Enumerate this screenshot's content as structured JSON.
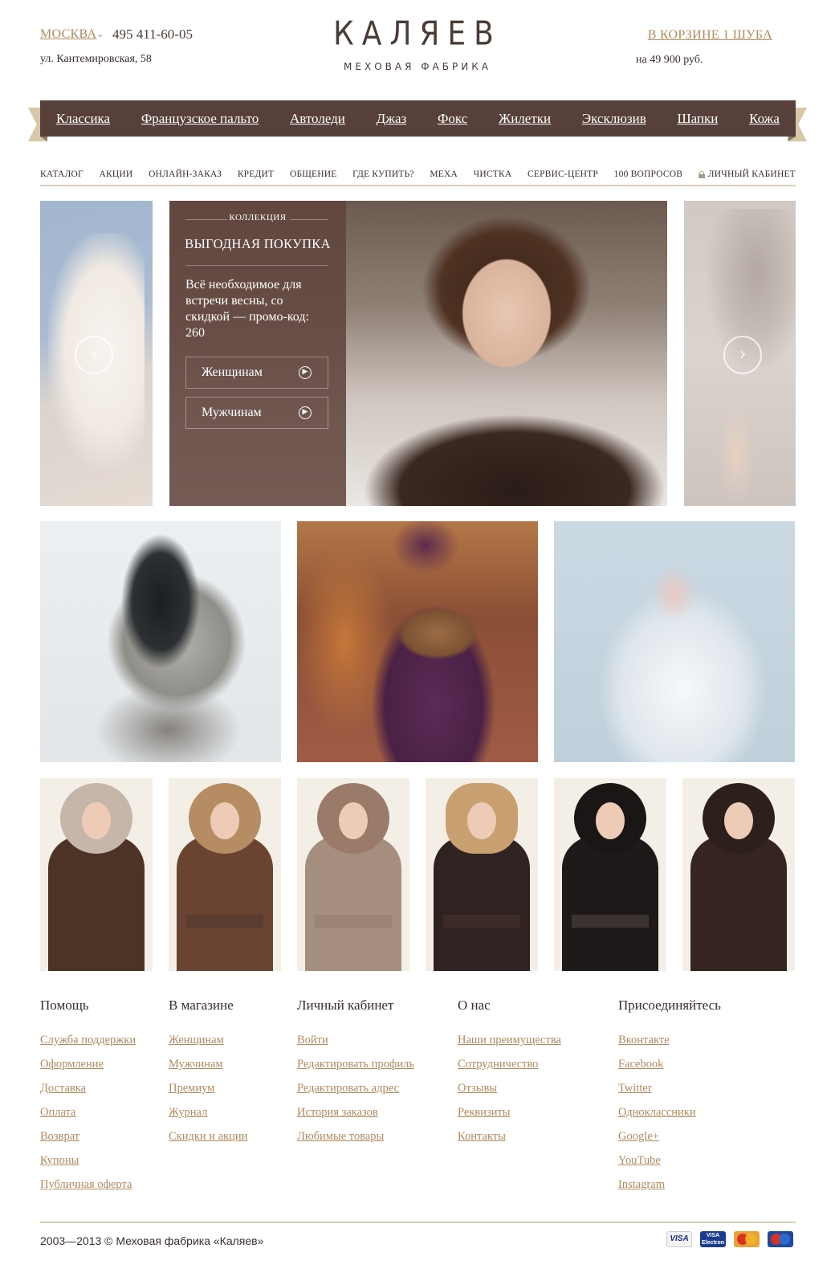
{
  "header": {
    "city": "МОСКВА",
    "phone": "495 411-60-05",
    "address": "ул. Кантемировская, 58",
    "logo": "КАЛЯЕВ",
    "logo_sub": "МЕХОВАЯ ФАБРИКА",
    "cart": "В КОРЗИНЕ 1 ШУБА",
    "cart_sum": "на 49 900 руб."
  },
  "ribbon": {
    "items": [
      "Классика",
      "Французское пальто",
      "Автоледи",
      "Джаз",
      "Фокс",
      "Жилетки",
      "Эксклюзив",
      "Шапки",
      "Кожа"
    ]
  },
  "subnav": {
    "items": [
      "КАТАЛОГ",
      "АКЦИИ",
      "ОНЛАЙН-ЗАКАЗ",
      "КРЕДИТ",
      "ОБЩЕНИЕ",
      "ГДЕ КУПИТЬ?",
      "МЕХА",
      "ЧИСТКА",
      "СЕРВИС-ЦЕНТР",
      "100 ВОПРОСОВ"
    ],
    "account": "ЛИЧНЫЙ КАБИНЕТ"
  },
  "hero": {
    "collection": "КОЛЛЕКЦИЯ",
    "title": "ВЫГОДНАЯ ПОКУПКА",
    "text": "Всё необходимое для встречи весны, со скидкой — промо-код: 260",
    "btn_women": "Женщинам",
    "btn_men": "Мужчинам",
    "prev": "‹",
    "next": "›"
  },
  "footer": {
    "cols": [
      {
        "title": "Помощь",
        "links": [
          "Служба поддержки",
          "Оформление",
          "Доставка",
          "Оплата",
          "Возврат",
          "Купоны",
          "Публичная оферта"
        ]
      },
      {
        "title": "В магазине",
        "links": [
          "Женщинам",
          "Мужчинам",
          "Премиум",
          "Журнал",
          "Скидки и акции"
        ]
      },
      {
        "title": "Личный кабинет",
        "links": [
          "Войти",
          "Редактировать профиль",
          "Редактировать адрес",
          "История заказов",
          "Любимые товары"
        ]
      },
      {
        "title": "О нас",
        "links": [
          "Наши преимущества",
          "Сотрудничество",
          "Отзывы",
          "Реквизиты",
          "Контакты"
        ]
      },
      {
        "title": "Присоединяйтесь",
        "links": [
          "Вконтакте",
          "Facebook",
          "Twitter",
          "Одноклассники",
          "Google+",
          "YouTube",
          "Instagram"
        ]
      }
    ],
    "copyright": "2003—2013 © Меховая фабрика «Каляев»",
    "payments": [
      "VISA",
      "VISA Electron",
      "MasterCard",
      "Maestro"
    ]
  },
  "colors": {
    "accent": "#b08a5c",
    "ribbon": "#574039",
    "ribbon_end": "#d6c8a8",
    "text": "#3a2e2a"
  }
}
